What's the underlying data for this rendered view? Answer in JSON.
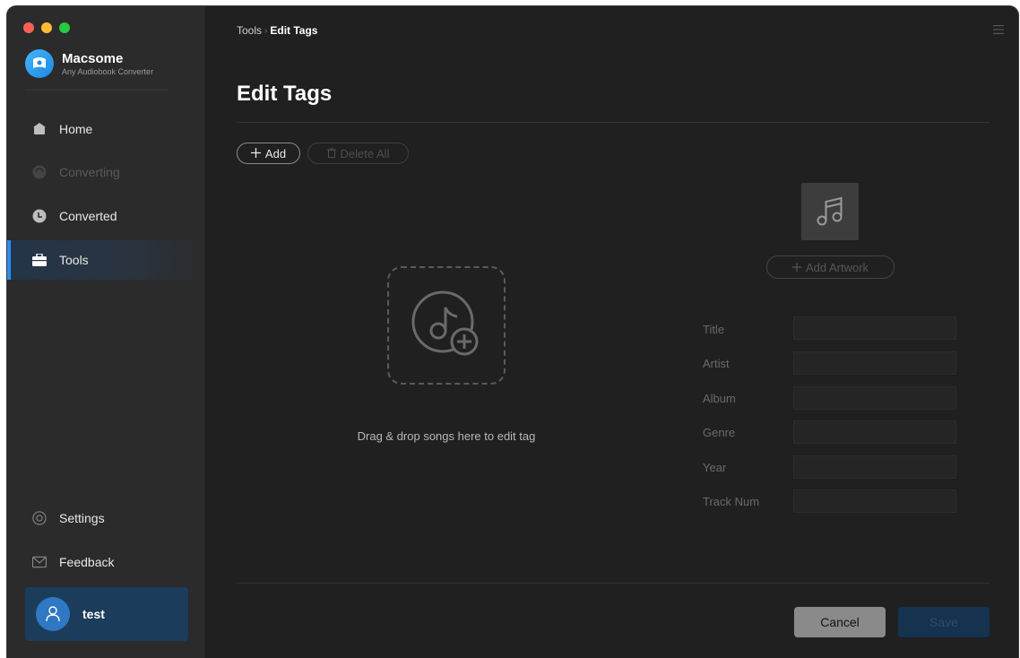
{
  "app": {
    "name": "Macsome",
    "subtitle": "Any Audiobook Converter"
  },
  "sidebar": {
    "items": [
      {
        "label": "Home",
        "icon": "home-icon",
        "state": "normal"
      },
      {
        "label": "Converting",
        "icon": "converting-icon",
        "state": "disabled"
      },
      {
        "label": "Converted",
        "icon": "clock-icon",
        "state": "normal"
      },
      {
        "label": "Tools",
        "icon": "toolbox-icon",
        "state": "active"
      }
    ],
    "bottom_items": [
      {
        "label": "Settings",
        "icon": "gear-icon"
      },
      {
        "label": "Feedback",
        "icon": "mail-icon"
      }
    ],
    "user": {
      "name": "test"
    }
  },
  "header": {
    "breadcrumb_parent": "Tools",
    "breadcrumb_separator": "›",
    "breadcrumb_current": "Edit Tags"
  },
  "main": {
    "title": "Edit Tags",
    "toolbar": {
      "add_label": "Add",
      "delete_all_label": "Delete All"
    },
    "drop_text": "Drag & drop songs here to edit tag",
    "add_artwork_label": "Add Artwork",
    "fields": [
      {
        "label": "Title",
        "value": ""
      },
      {
        "label": "Artist",
        "value": ""
      },
      {
        "label": "Album",
        "value": ""
      },
      {
        "label": "Genre",
        "value": ""
      },
      {
        "label": "Year",
        "value": ""
      },
      {
        "label": "Track Num",
        "value": ""
      }
    ],
    "cancel_label": "Cancel",
    "save_label": "Save"
  },
  "colors": {
    "accent": "#2d8cf0",
    "background": "#202020",
    "sidebar": "#2b2b2b",
    "user_card": "#1c3c5c"
  }
}
